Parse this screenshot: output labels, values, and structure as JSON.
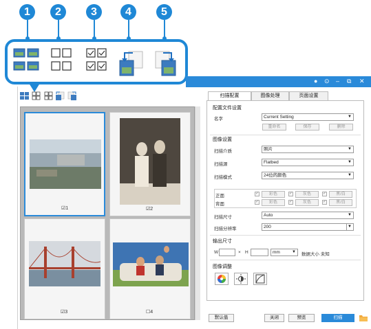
{
  "callouts": [
    "1",
    "2",
    "3",
    "4",
    "5"
  ],
  "window": {
    "controls": [
      "●",
      "⊙",
      "–",
      "⧉",
      "✕"
    ]
  },
  "thumbnails": [
    {
      "check_label": "☑1",
      "selected": true
    },
    {
      "check_label": "☑2",
      "selected": false
    },
    {
      "check_label": "☑3",
      "selected": false
    },
    {
      "check_label": "☐4",
      "selected": false
    }
  ],
  "tabs": [
    "扫描配置",
    "图像处理",
    "页面设置"
  ],
  "profile": {
    "section": "配置文件设置",
    "name_label": "名字",
    "name_value": "Current Setting",
    "buttons": [
      "重命名",
      "保存",
      "删除"
    ]
  },
  "image_settings": {
    "section": "图像设置",
    "rows": [
      {
        "label": "扫描介质",
        "value": "照片"
      },
      {
        "label": "扫描源",
        "value": "Flatbed"
      },
      {
        "label": "扫描模式",
        "value": "24位的颜色"
      }
    ],
    "front_label": "正面",
    "back_label": "背面",
    "color_options": [
      "彩色",
      "灰色",
      "黑/白"
    ],
    "size_label": "扫描尺寸",
    "size_value": "Auto",
    "dpi_label": "扫描分辨率",
    "dpi_value": "200"
  },
  "output": {
    "section": "输出尺寸",
    "w_label": "W",
    "x_label": "×",
    "h_label": "H",
    "unit": "mm",
    "size_text": "数据大小 未知"
  },
  "adjust": {
    "section": "图像调整"
  },
  "bottom": {
    "default_label": "默认值",
    "close_label": "关闭",
    "preview_label": "预览",
    "scan_label": "扫描"
  },
  "colors": {
    "accent": "#2a8ad9",
    "callout": "#1f88d6",
    "panel_bg": "#b9b9b9",
    "folder": "#f2a93b"
  }
}
